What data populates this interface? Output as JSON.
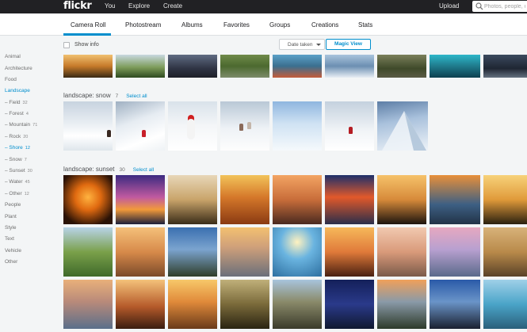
{
  "header": {
    "logo": "flickr",
    "nav": [
      {
        "label": "You"
      },
      {
        "label": "Explore"
      },
      {
        "label": "Create"
      }
    ],
    "upload": "Upload",
    "search_placeholder": "Photos, people, or groups",
    "background": "#212124"
  },
  "subnav": {
    "tabs": [
      {
        "label": "Camera Roll",
        "active": true
      },
      {
        "label": "Photostream"
      },
      {
        "label": "Albums"
      },
      {
        "label": "Favorites"
      },
      {
        "label": "Groups"
      },
      {
        "label": "Creations"
      },
      {
        "label": "Stats"
      }
    ],
    "accent": "#008ecd"
  },
  "sidebar": {
    "categories": [
      {
        "label": "Animal"
      },
      {
        "label": "Architecture"
      },
      {
        "label": "Food"
      },
      {
        "label": "Landscape",
        "active": true
      },
      {
        "label": "Field",
        "count": "32",
        "sub": true
      },
      {
        "label": "Forest",
        "count": "4",
        "sub": true
      },
      {
        "label": "Mountain",
        "count": "71",
        "sub": true
      },
      {
        "label": "Rock",
        "count": "20",
        "sub": true
      },
      {
        "label": "Shore",
        "count": "12",
        "sub": true,
        "active": true
      },
      {
        "label": "Snow",
        "count": "7",
        "sub": true
      },
      {
        "label": "Sunset",
        "count": "30",
        "sub": true
      },
      {
        "label": "Water",
        "count": "45",
        "sub": true
      },
      {
        "label": "Other",
        "count": "12",
        "sub": true
      },
      {
        "label": "People"
      },
      {
        "label": "Plant"
      },
      {
        "label": "Style"
      },
      {
        "label": "Text"
      },
      {
        "label": "Vehicle"
      },
      {
        "label": "Other"
      }
    ]
  },
  "toolbar": {
    "show_info": "Show info",
    "show_info_checked": false,
    "sort": "Date taken",
    "magic_view": "Magic View"
  },
  "sections": {
    "snow": {
      "title": "landscape: snow",
      "count": "7",
      "select_all": "Select all"
    },
    "sunset": {
      "title": "landscape: sunset",
      "count": "30",
      "select_all": "Select all"
    }
  }
}
